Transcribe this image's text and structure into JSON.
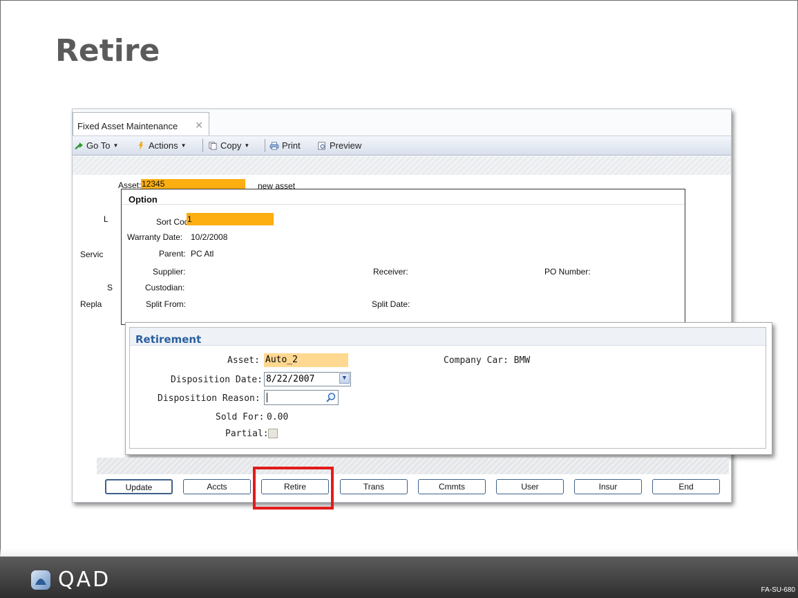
{
  "slide": {
    "title": "Retire",
    "footer_logo": "QAD",
    "footer_code": "FA-SU-680"
  },
  "window": {
    "tab_title": "Fixed Asset Maintenance",
    "toolbar": {
      "goto": "Go To",
      "actions": "Actions",
      "copy": "Copy",
      "print": "Print",
      "preview": "Preview"
    },
    "asset_label": "Asset:",
    "asset_value": "12345",
    "asset_desc": "new asset",
    "left_labels": [
      "L",
      "Servic",
      "S",
      "Repla"
    ]
  },
  "option": {
    "header": "Option",
    "sort_code_label": "Sort Code:",
    "sort_code_value": "1",
    "warranty_label": "Warranty Date:",
    "warranty_value": "10/2/2008",
    "parent_label": "Parent:",
    "parent_value": "PC Atl",
    "supplier_label": "Supplier:",
    "receiver_label": "Receiver:",
    "po_label": "PO Number:",
    "custodian_label": "Custodian:",
    "split_from_label": "Split From:",
    "split_date_label": "Split Date:"
  },
  "retirement": {
    "title": "Retirement",
    "asset_label": "Asset:",
    "asset_value": "Auto_2",
    "asset_desc": "Company Car: BMW",
    "disp_date_label": "Disposition Date:",
    "disp_date_value": "8/22/2007",
    "disp_reason_label": "Disposition Reason:",
    "disp_reason_value": "",
    "sold_for_label": "Sold For:",
    "sold_for_value": "0.00",
    "partial_label": "Partial:"
  },
  "buttons": [
    "Update",
    "Accts",
    "Retire",
    "Trans",
    "Cmmts",
    "User",
    "Insur",
    "End"
  ],
  "colors": {
    "highlight": "#fdae10",
    "retire_title": "#2b5f9e",
    "callout": "#e21b1b"
  }
}
